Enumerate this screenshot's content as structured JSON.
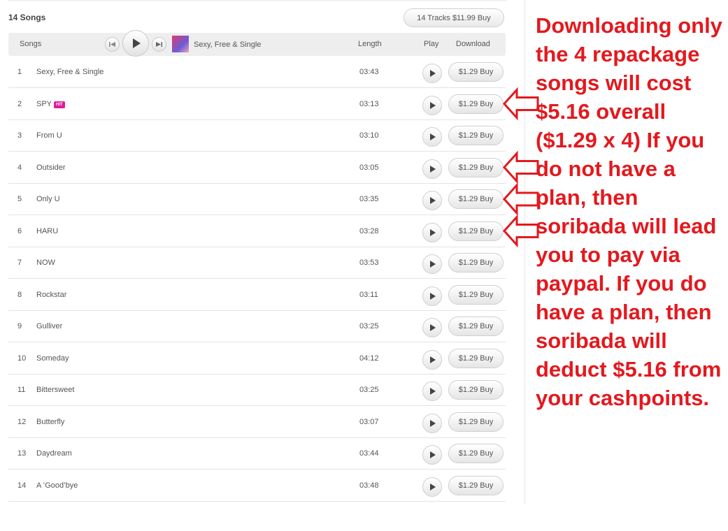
{
  "album": {
    "songs_count": "14 Songs",
    "buy_all_label": "14 Tracks $11.99 Buy",
    "now_playing": "Sexy, Free & Single"
  },
  "columns": {
    "songs": "Songs",
    "length": "Length",
    "play": "Play",
    "download": "Download"
  },
  "tracks": [
    {
      "num": "1",
      "title": "Sexy, Free & Single",
      "badge": "",
      "length": "03:43",
      "buy": "$1.29 Buy"
    },
    {
      "num": "2",
      "title": "SPY",
      "badge": "HIT",
      "length": "03:13",
      "buy": "$1.29 Buy"
    },
    {
      "num": "3",
      "title": "From U",
      "badge": "",
      "length": "03:10",
      "buy": "$1.29 Buy"
    },
    {
      "num": "4",
      "title": "Outsider",
      "badge": "",
      "length": "03:05",
      "buy": "$1.29 Buy"
    },
    {
      "num": "5",
      "title": "Only U",
      "badge": "",
      "length": "03:35",
      "buy": "$1.29 Buy"
    },
    {
      "num": "6",
      "title": "HARU",
      "badge": "",
      "length": "03:28",
      "buy": "$1.29 Buy"
    },
    {
      "num": "7",
      "title": "NOW",
      "badge": "",
      "length": "03:53",
      "buy": "$1.29 Buy"
    },
    {
      "num": "8",
      "title": "Rockstar",
      "badge": "",
      "length": "03:11",
      "buy": "$1.29 Buy"
    },
    {
      "num": "9",
      "title": "Gulliver",
      "badge": "",
      "length": "03:25",
      "buy": "$1.29 Buy"
    },
    {
      "num": "10",
      "title": "Someday",
      "badge": "",
      "length": "04:12",
      "buy": "$1.29 Buy"
    },
    {
      "num": "11",
      "title": "Bittersweet",
      "badge": "",
      "length": "03:25",
      "buy": "$1.29 Buy"
    },
    {
      "num": "12",
      "title": "Butterfly",
      "badge": "",
      "length": "03:07",
      "buy": "$1.29 Buy"
    },
    {
      "num": "13",
      "title": "Daydream",
      "badge": "",
      "length": "03:44",
      "buy": "$1.29 Buy"
    },
    {
      "num": "14",
      "title": "A ‘Good’bye",
      "badge": "",
      "length": "03:48",
      "buy": "$1.29 Buy"
    }
  ],
  "annotation": {
    "text": "Downloading only the 4 repackage songs will cost $5.16 overall ($1.29 x 4) If you do not have a plan, then soribada will lead you to pay via paypal. If you do have a plan, then soribada will deduct $5.16 from your cashpoints.",
    "color": "#e3191e",
    "arrows_point_to_tracks": [
      "2",
      "4",
      "5",
      "6"
    ]
  }
}
